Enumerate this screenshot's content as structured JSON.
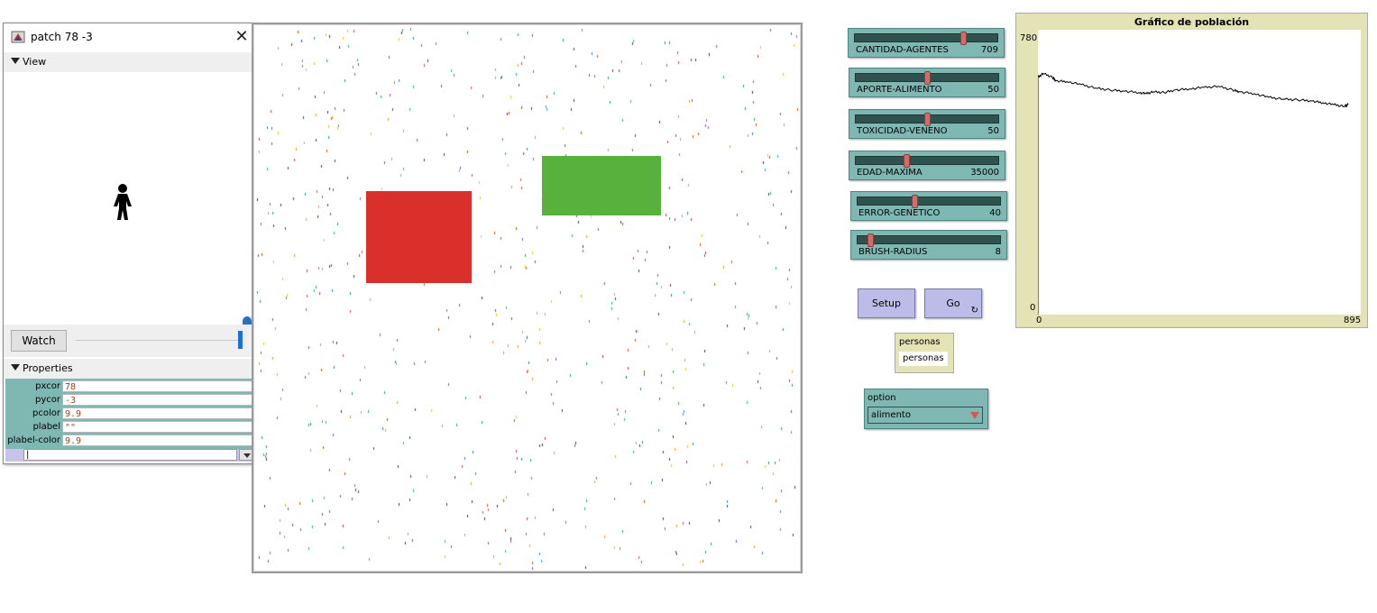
{
  "inspector": {
    "title": "patch 78 -3",
    "view_section": "View",
    "watch_label": "Watch",
    "properties_section": "Properties",
    "properties": [
      {
        "key": "pxcor",
        "value": "78"
      },
      {
        "key": "pycor",
        "value": "-3"
      },
      {
        "key": "pcolor",
        "value": "9.9"
      },
      {
        "key": "plabel",
        "value": "\"\""
      },
      {
        "key": "plabel-color",
        "value": "9.9"
      }
    ],
    "command_value": "|"
  },
  "world": {
    "background": "#ffffff",
    "red_patch_color": "#d9302b",
    "green_patch_color": "#58b03d"
  },
  "sliders": [
    {
      "name": "CANTIDAD-AGENTES",
      "value": "709",
      "fraction": 0.77
    },
    {
      "name": "APORTE-ALIMENTO",
      "value": "50",
      "fraction": 0.5
    },
    {
      "name": "TOXICIDAD-VENENO",
      "value": "50",
      "fraction": 0.5
    },
    {
      "name": "EDAD-MAXIMA",
      "value": "35000",
      "fraction": 0.35
    },
    {
      "name": "ERROR-GENETICO",
      "value": "40",
      "fraction": 0.4
    },
    {
      "name": "BRUSH-RADIUS",
      "value": "8",
      "fraction": 0.08
    }
  ],
  "buttons": {
    "setup": "Setup",
    "go": "Go",
    "go_forever_icon": "↻"
  },
  "monitor": {
    "label": "personas",
    "value": "personas"
  },
  "chooser": {
    "label": "option",
    "value": "alimento"
  },
  "plot": {
    "title": "Gráfico de población",
    "y_max": "780",
    "y_min": "0",
    "x_min": "0",
    "x_max": "895"
  },
  "chart_data": {
    "type": "line",
    "title": "Gráfico de población",
    "xlabel": "",
    "ylabel": "",
    "xlim": [
      0,
      895
    ],
    "ylim": [
      0,
      780
    ],
    "series": [
      {
        "x": [
          0,
          15,
          40,
          50,
          80,
          120,
          160,
          200,
          240,
          280,
          300,
          320,
          350,
          380,
          420,
          460,
          500,
          540,
          560,
          600,
          640,
          680,
          720,
          760,
          790,
          820,
          850,
          860
        ],
        "values": [
          650,
          660,
          650,
          640,
          638,
          630,
          620,
          615,
          612,
          608,
          605,
          610,
          608,
          615,
          618,
          622,
          625,
          615,
          610,
          605,
          595,
          590,
          588,
          585,
          580,
          575,
          570,
          575
        ]
      }
    ],
    "grid": false
  }
}
